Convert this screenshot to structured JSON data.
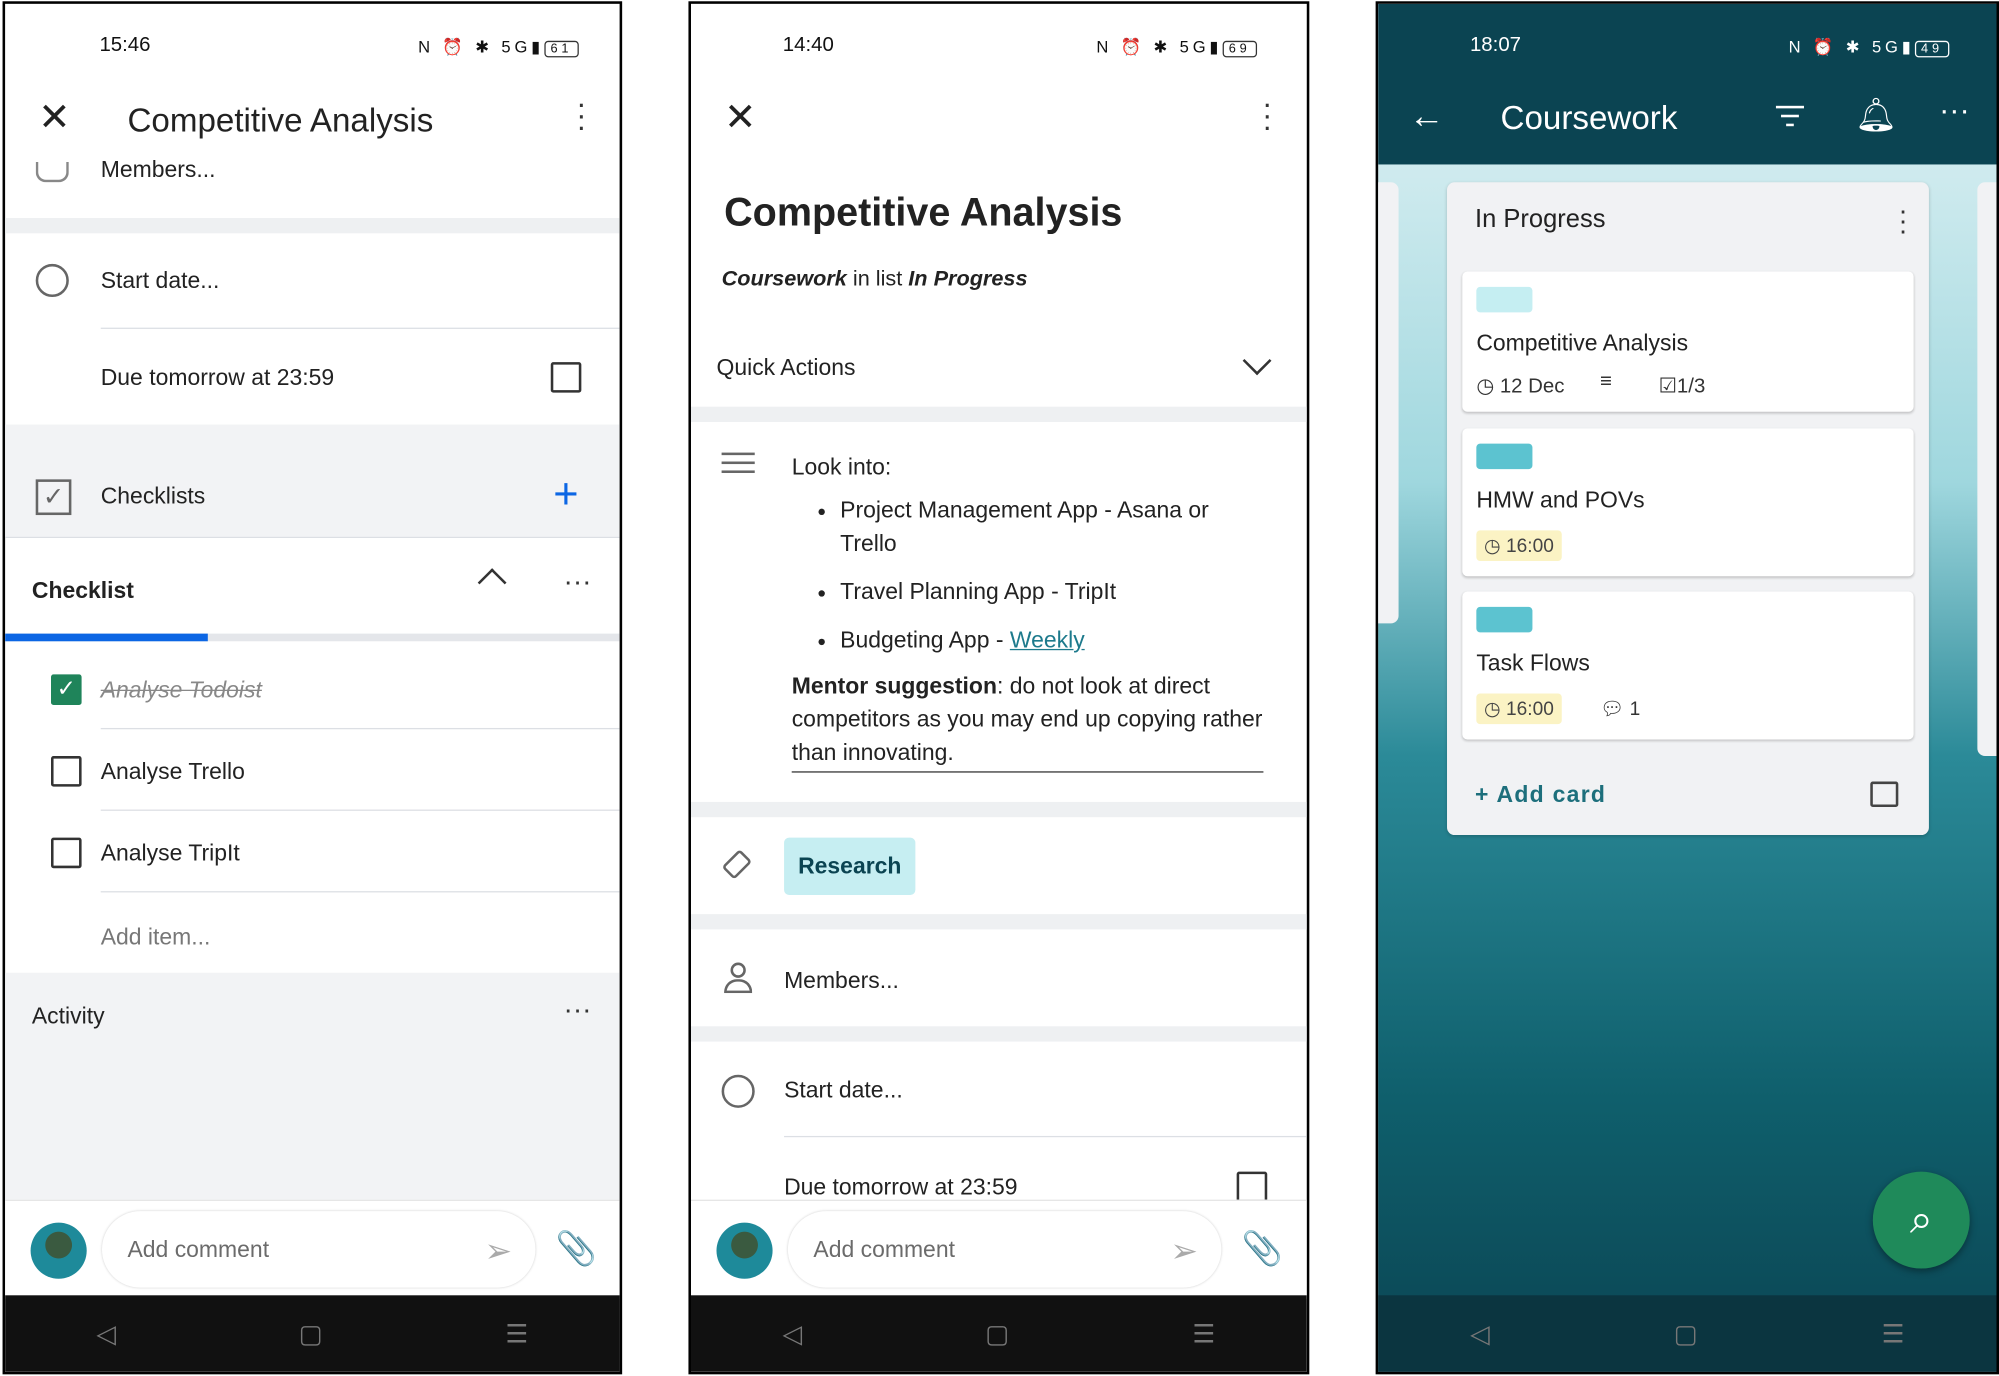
{
  "screen1": {
    "status_time": "15:46",
    "battery": "61",
    "title": "Competitive Analysis",
    "members": "Members...",
    "start_date": "Start date...",
    "due": "Due tomorrow at 23:59",
    "checklists_label": "Checklists",
    "checklist_title": "Checklist",
    "checklist_progress": 0.33,
    "items": [
      {
        "label": "Analyse Todoist",
        "checked": true
      },
      {
        "label": "Analyse Trello",
        "checked": false
      },
      {
        "label": "Analyse TripIt",
        "checked": false
      }
    ],
    "add_item": "Add item...",
    "activity": "Activity",
    "comment_placeholder": "Add comment"
  },
  "screen2": {
    "status_time": "14:40",
    "battery": "69",
    "title": "Competitive Analysis",
    "board": "Coursework",
    "in_list": " in list ",
    "list": "In Progress",
    "quick_actions": "Quick Actions",
    "desc_intro": "Look into:",
    "bullets": [
      "Project Management App - Asana or Trello",
      "Travel Planning App - TripIt",
      "Budgeting App - "
    ],
    "link": "Weekly",
    "mentor_bold": "Mentor suggestion",
    "mentor_text": ": do not look at direct competitors as you may end up copying rather than innovating.",
    "label": "Research",
    "members": "Members...",
    "start_date": "Start date...",
    "due": "Due tomorrow at 23:59",
    "comment_placeholder": "Add comment"
  },
  "screen3": {
    "status_time": "18:07",
    "battery": "49",
    "board_title": "Coursework",
    "list_title": "In Progress",
    "cards": [
      {
        "title": "Competitive Analysis",
        "label_color": "#c5eef2",
        "due": "12 Dec",
        "checklist": "1/3"
      },
      {
        "title": "HMW and POVs",
        "label_color": "#5cc3d0",
        "due": "16:00"
      },
      {
        "title": "Task Flows",
        "label_color": "#5cc3d0",
        "due": "16:00",
        "comments": "1"
      }
    ],
    "add_card": "+ Add card",
    "colors": {
      "header": "#0b4452",
      "fab": "#1f8a5a",
      "accent": "#0c66e4"
    }
  }
}
